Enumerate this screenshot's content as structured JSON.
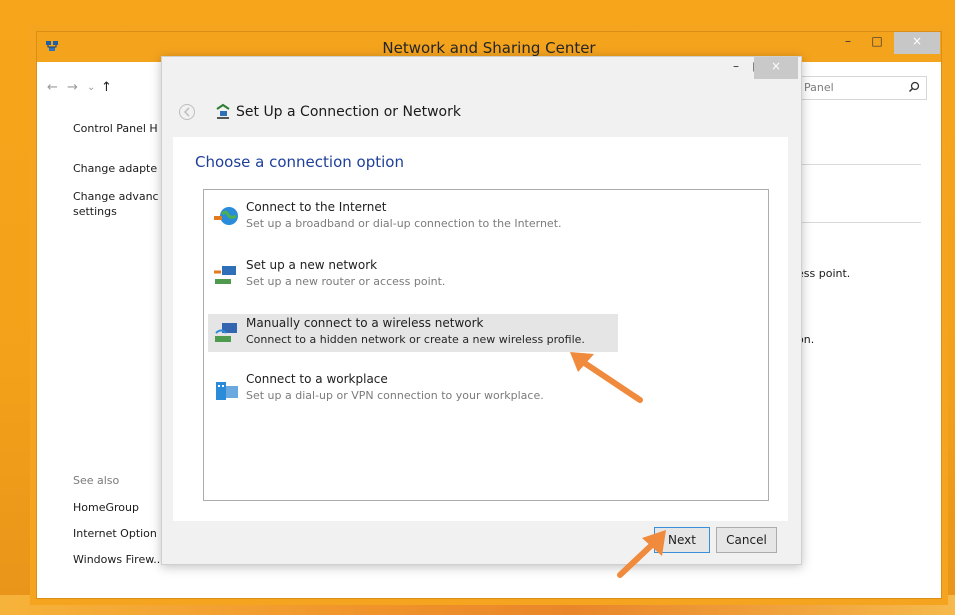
{
  "desktop": {
    "accent": "#f4a31d"
  },
  "main_window": {
    "title": "Network and Sharing Center",
    "caption": {
      "minimize": "–",
      "maximize": "□",
      "close": "×"
    },
    "nav": {
      "back": "←",
      "forward": "→",
      "recent": "⌄",
      "up": "↑"
    },
    "search": {
      "placeholder": "Panel"
    },
    "left_pane": {
      "items": [
        "Control Panel H",
        "Change adapte",
        "Change advanc",
        "settings"
      ],
      "see_also": "See also",
      "see_also_items": [
        "HomeGroup",
        "Internet Option",
        "Windows Firew..."
      ]
    },
    "right_pane": {
      "line1": "ess point.",
      "line2": "on."
    }
  },
  "dialog": {
    "title": "Set Up a Connection or Network",
    "caption": {
      "minimize": "–",
      "maximize": "□",
      "close": "×"
    },
    "heading": "Choose a connection option",
    "options": [
      {
        "title": "Connect to the Internet",
        "subtitle": "Set up a broadband or dial-up connection to the Internet.",
        "icon": "globe-icon"
      },
      {
        "title": "Set up a new network",
        "subtitle": "Set up a new router or access point.",
        "icon": "router-icon"
      },
      {
        "title": "Manually connect to a wireless network",
        "subtitle": "Connect to a hidden network or create a new wireless profile.",
        "icon": "wireless-icon",
        "selected": true
      },
      {
        "title": "Connect to a workplace",
        "subtitle": "Set up a dial-up or VPN connection to your workplace.",
        "icon": "workplace-icon"
      }
    ],
    "buttons": {
      "next": "Next",
      "cancel": "Cancel"
    }
  },
  "annotations": {
    "arrow_color": "#f08a3c"
  }
}
